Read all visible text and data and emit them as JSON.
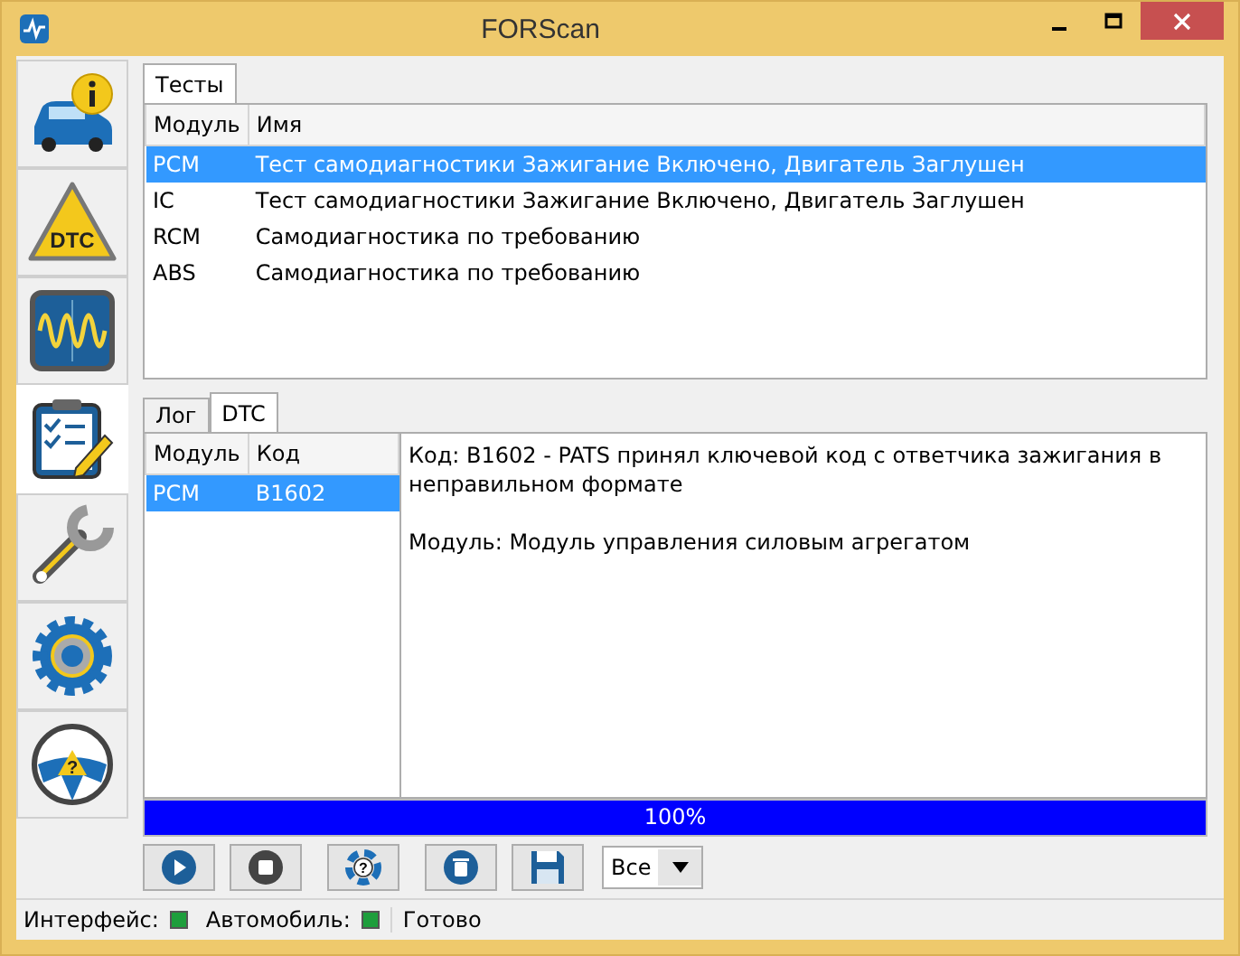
{
  "window": {
    "title": "FORScan"
  },
  "sidebar": {
    "items": [
      {
        "kind": "info",
        "selected": false
      },
      {
        "kind": "dtc",
        "selected": false,
        "label": "DTC"
      },
      {
        "kind": "oscilloscope",
        "selected": false
      },
      {
        "kind": "tests",
        "selected": true
      },
      {
        "kind": "service",
        "selected": false
      },
      {
        "kind": "settings",
        "selected": false
      },
      {
        "kind": "help",
        "selected": false,
        "label": "?"
      }
    ]
  },
  "tests_tabs": [
    {
      "label": "Тесты",
      "selected": true
    }
  ],
  "tests_table": {
    "columns": [
      "Модуль",
      "Имя"
    ],
    "rows": [
      {
        "cells": [
          "PCM",
          "Тест самодиагностики Зажигание Включено, Двигатель Заглушен"
        ],
        "selected": true
      },
      {
        "cells": [
          "IC",
          "Тест самодиагностики Зажигание Включено, Двигатель Заглушен"
        ],
        "selected": false
      },
      {
        "cells": [
          "RCM",
          "Самодиагностика по требованию"
        ],
        "selected": false
      },
      {
        "cells": [
          "ABS",
          "Самодиагностика по требованию"
        ],
        "selected": false
      }
    ]
  },
  "result_tabs": [
    {
      "label": "Лог",
      "selected": false
    },
    {
      "label": "DTC",
      "selected": true
    }
  ],
  "dtc_table": {
    "columns": [
      "Модуль",
      "Код"
    ],
    "rows": [
      {
        "cells": [
          "PCM",
          "B1602"
        ],
        "selected": true
      }
    ]
  },
  "dtc_details": [
    "Код: B1602 - PATS принял ключевой код с ответчика зажигания в неправильном формате",
    "Модуль: Модуль управления силовым агрегатом"
  ],
  "progress": {
    "level": 1,
    "reading": "100%"
  },
  "toolbar": [
    {
      "kind": "play"
    },
    {
      "kind": "stop"
    },
    {
      "kind": "help",
      "label": "?"
    },
    {
      "kind": "delete"
    },
    {
      "kind": "save"
    }
  ],
  "filter": {
    "value": "Все"
  },
  "status_bar": {
    "indicators": [
      {
        "label": "Интерфейс:",
        "color": "#1e9e3c"
      },
      {
        "label": "Автомобиль:",
        "color": "#1e9e3c"
      }
    ],
    "message": "Готово"
  }
}
